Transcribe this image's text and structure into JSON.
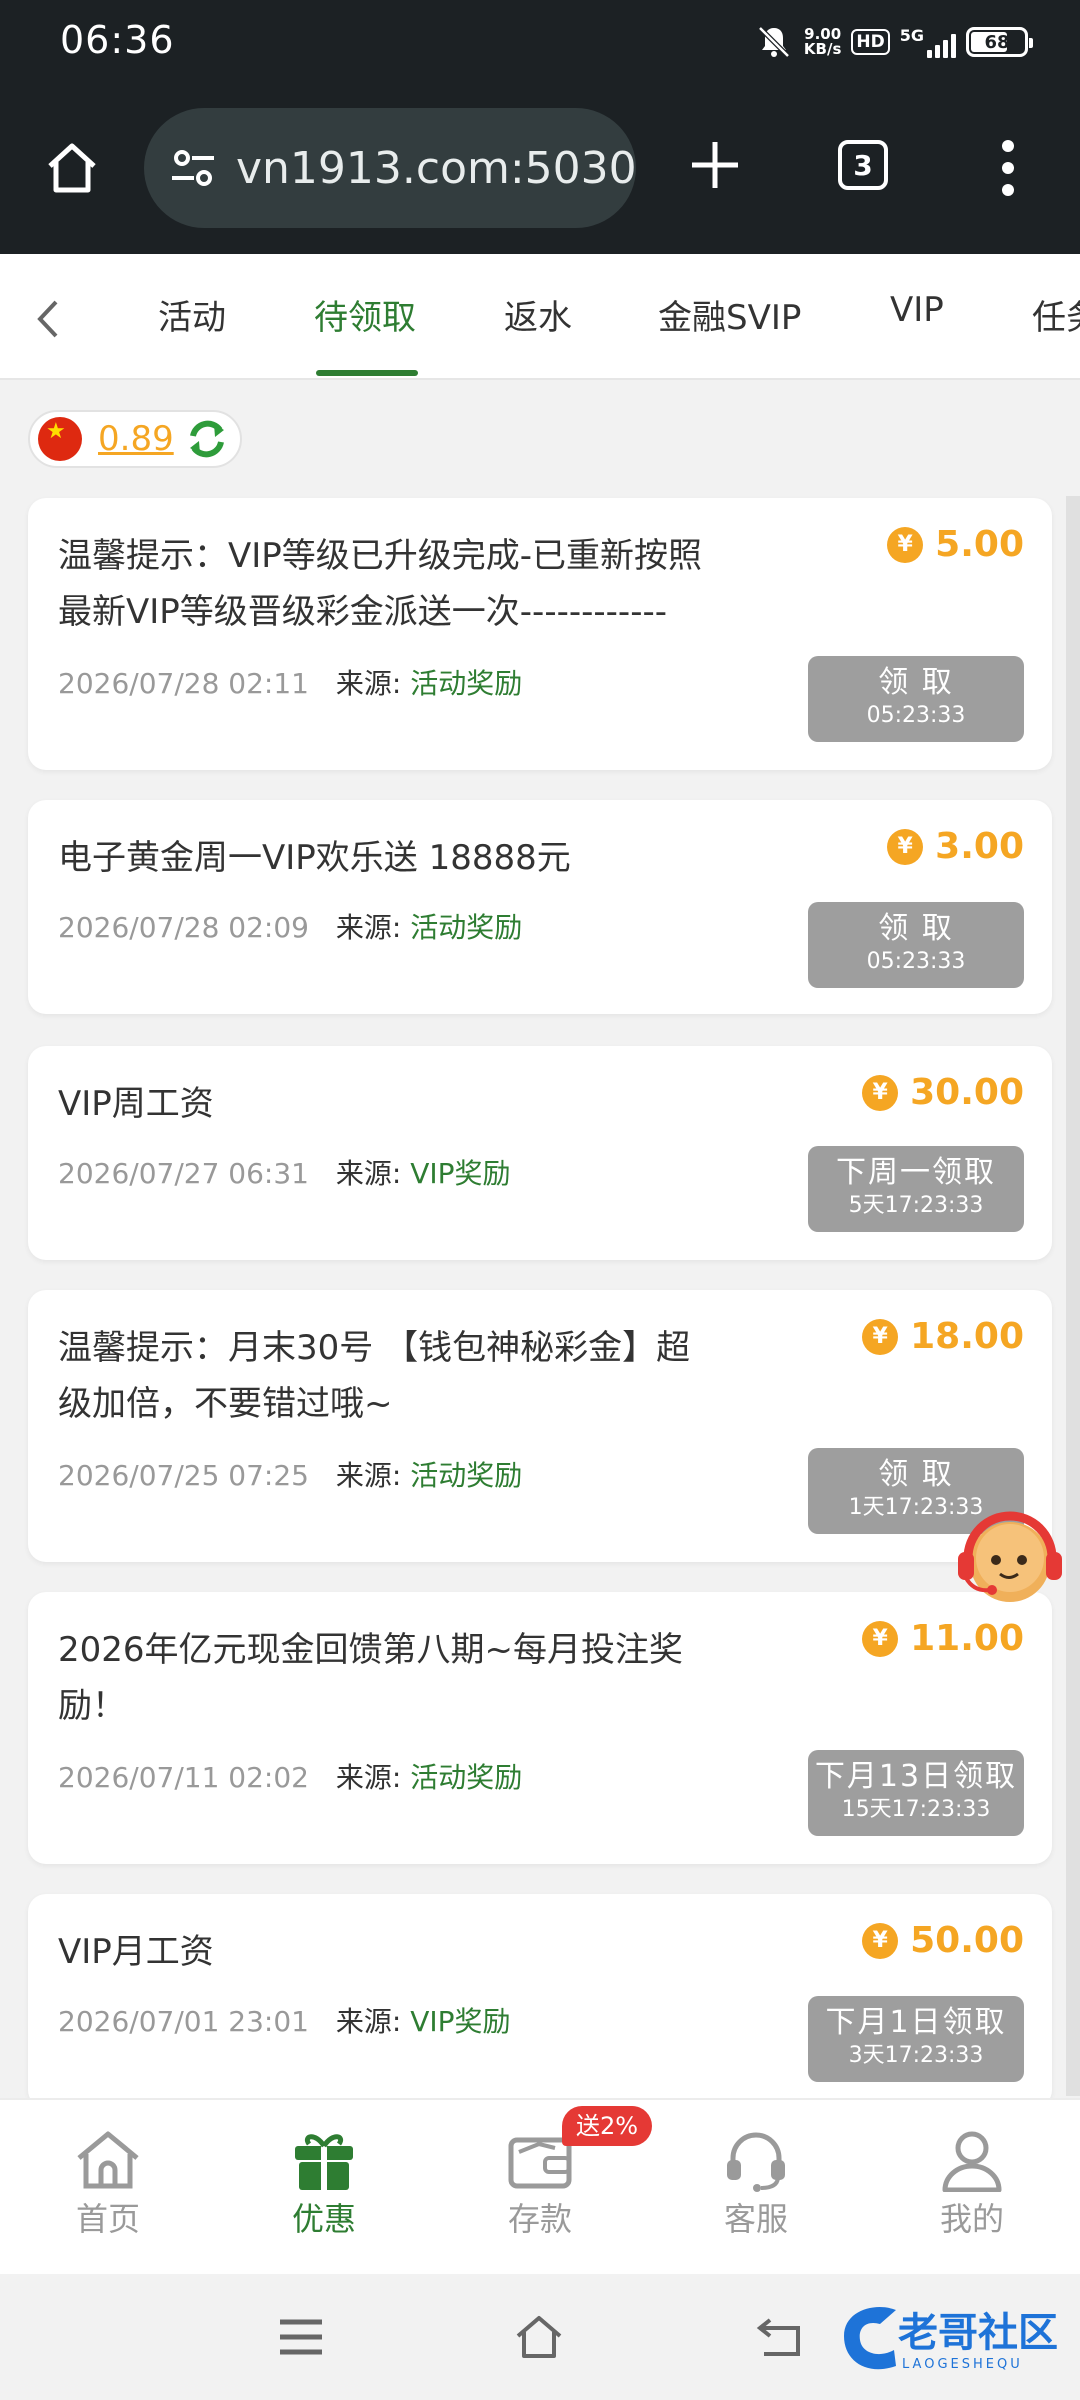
{
  "status_bar": {
    "time": "06:36",
    "net_speed": "9.00",
    "net_unit": "KB/s",
    "hd": "HD",
    "network": "5G",
    "battery": "68"
  },
  "browser": {
    "url": "vn1913.com:5030",
    "tab_count": "3"
  },
  "tabs": [
    {
      "label": "活动",
      "active": false
    },
    {
      "label": "待领取",
      "active": true
    },
    {
      "label": "返水",
      "active": false
    },
    {
      "label": "金融SVIP",
      "active": false
    },
    {
      "label": "VIP",
      "active": false
    },
    {
      "label": "任务",
      "active": false
    }
  ],
  "balance": {
    "value": "0.89"
  },
  "source_label": "来源:",
  "cards": [
    {
      "title": "温馨提示：VIP等级已升级完成-已重新按照最新VIP等级晋级彩金派送一次------------",
      "amount": "5.00",
      "date": "2026/07/28 02:11",
      "source": "活动奖励",
      "button_label": "领 取",
      "countdown": "05:23:33"
    },
    {
      "title": "电子黄金周一VIP欢乐送 18888元",
      "amount": "3.00",
      "date": "2026/07/28 02:09",
      "source": "活动奖励",
      "button_label": "领 取",
      "countdown": "05:23:33"
    },
    {
      "title": "VIP周工资",
      "amount": "30.00",
      "date": "2026/07/27 06:31",
      "source": "VIP奖励",
      "button_label": "下周一领取",
      "countdown": "5天17:23:33"
    },
    {
      "title": "温馨提示：月末30号 【钱包神秘彩金】超级加倍，不要错过哦~",
      "amount": "18.00",
      "date": "2026/07/25 07:25",
      "source": "活动奖励",
      "button_label": "领 取",
      "countdown": "1天17:23:33"
    },
    {
      "title": "2026年亿元现金回馈第八期~每月投注奖励！",
      "amount": "11.00",
      "date": "2026/07/11 02:02",
      "source": "活动奖励",
      "button_label": "下月13日领取",
      "countdown": "15天17:23:33"
    },
    {
      "title": "VIP月工资",
      "amount": "50.00",
      "date": "2026/07/01 23:01",
      "source": "VIP奖励",
      "button_label": "下月1日领取",
      "countdown": "3天17:23:33"
    }
  ],
  "bottom_nav": [
    {
      "label": "首页",
      "icon": "home-icon",
      "active": false
    },
    {
      "label": "优惠",
      "icon": "gift-icon",
      "active": true
    },
    {
      "label": "存款",
      "icon": "wallet-icon",
      "active": false
    },
    {
      "label": "客服",
      "icon": "headset-icon",
      "active": false
    },
    {
      "label": "我的",
      "icon": "user-icon",
      "active": false
    }
  ],
  "deposit_badge": "送2%",
  "watermark": {
    "name": "老哥社区",
    "sub": "LAOGESHEQU"
  },
  "colors": {
    "accent_green": "#2e7d32",
    "amount_gold": "#f5a623",
    "button_gray": "#9e9e9e",
    "badge_red": "#e53935",
    "topbar_dark": "#1c2124"
  }
}
